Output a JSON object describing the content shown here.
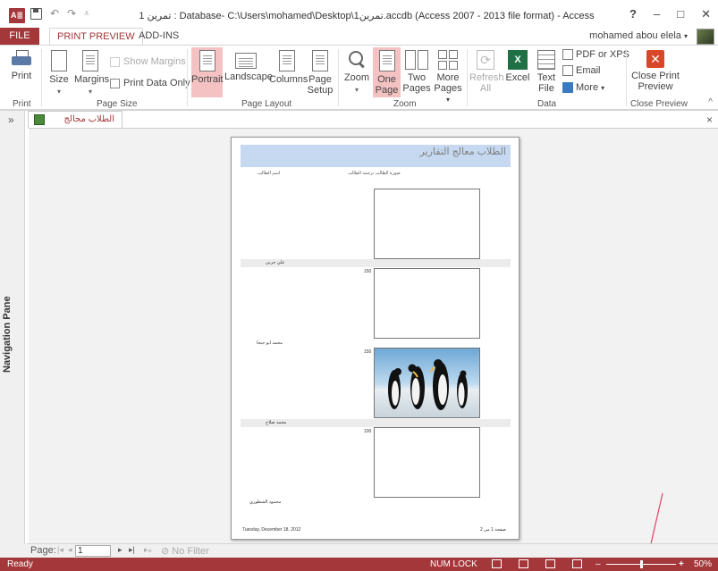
{
  "titlebar": {
    "app_icon_text": "A≣",
    "title": "تمرين 1 : Database- C:\\Users\\mohamed\\Desktop\\تمرين1.accdb (Access 2007 - 2013 file format) - Access",
    "help": "?",
    "minimize": "–",
    "restore": "□",
    "close": "✕",
    "undo": "↶",
    "redo": "↷",
    "qat_more": "⩡"
  },
  "tabs": {
    "file": "FILE",
    "print_preview": "PRINT PREVIEW",
    "add_ins": "ADD-INS",
    "user": "mohamed abou elela",
    "user_caret": "▾"
  },
  "ribbon": {
    "print": "Print",
    "size": "Size",
    "margins": "Margins",
    "show_margins": "Show Margins",
    "print_data_only": "Print Data Only",
    "portrait": "Portrait",
    "landscape": "Landscape",
    "columns": "Columns",
    "page": "Page",
    "setup": "Setup",
    "zoom": "Zoom",
    "one": "One",
    "one_page": "Page",
    "two": "Two",
    "two_pages": "Pages",
    "more": "More",
    "more_pages": "Pages",
    "refresh": "Refresh",
    "all": "All",
    "excel": "Excel",
    "text": "Text",
    "file": "File",
    "pdf_xps": "PDF or XPS",
    "email": "Email",
    "more_data": "More",
    "close_print": "Close Print",
    "preview": "Preview",
    "groups": {
      "print": "Print",
      "page_size": "Page Size",
      "page_layout": "Page Layout",
      "zoom": "Zoom",
      "data": "Data",
      "close_preview": "Close Preview"
    },
    "collapse": "^"
  },
  "nav": {
    "chevron": "»",
    "label": "Navigation Pane"
  },
  "document_tab": {
    "label": "الطلاب مجالج التقارير",
    "close": "×"
  },
  "report": {
    "title": "الطلاب معالج التقارير",
    "col_name": "اسم الطالب",
    "col_photo": "صورة الطالب ترجمة الطالب",
    "records": [
      {
        "name": "علي حربي",
        "num": ""
      },
      {
        "name": "محمد ابو جبحا",
        "num": "150"
      },
      {
        "name": "محمد صلاح",
        "num": "150"
      },
      {
        "name": "محمود الشطوري",
        "num": "100"
      }
    ],
    "footer_date": "Tuesday, December 18, 2012",
    "footer_page": "صفحة 1 من 2"
  },
  "record_nav": {
    "page_label": "Page:",
    "first": "|◂",
    "prev": "◂",
    "current": "1",
    "next": "▸",
    "last": "▸|",
    "new": "▸⁎",
    "no_filter": "No Filter"
  },
  "status": {
    "ready": "Ready",
    "num_lock": "NUM LOCK",
    "zoom_pct": "50%",
    "zoom_out": "–",
    "zoom_in": "+",
    "zoom_level": 0.5
  },
  "colors": {
    "accent": "#a4373a",
    "highlight": "#f4c2c2",
    "report_header": "#c6d9f0",
    "annotation": "#e0406a"
  }
}
